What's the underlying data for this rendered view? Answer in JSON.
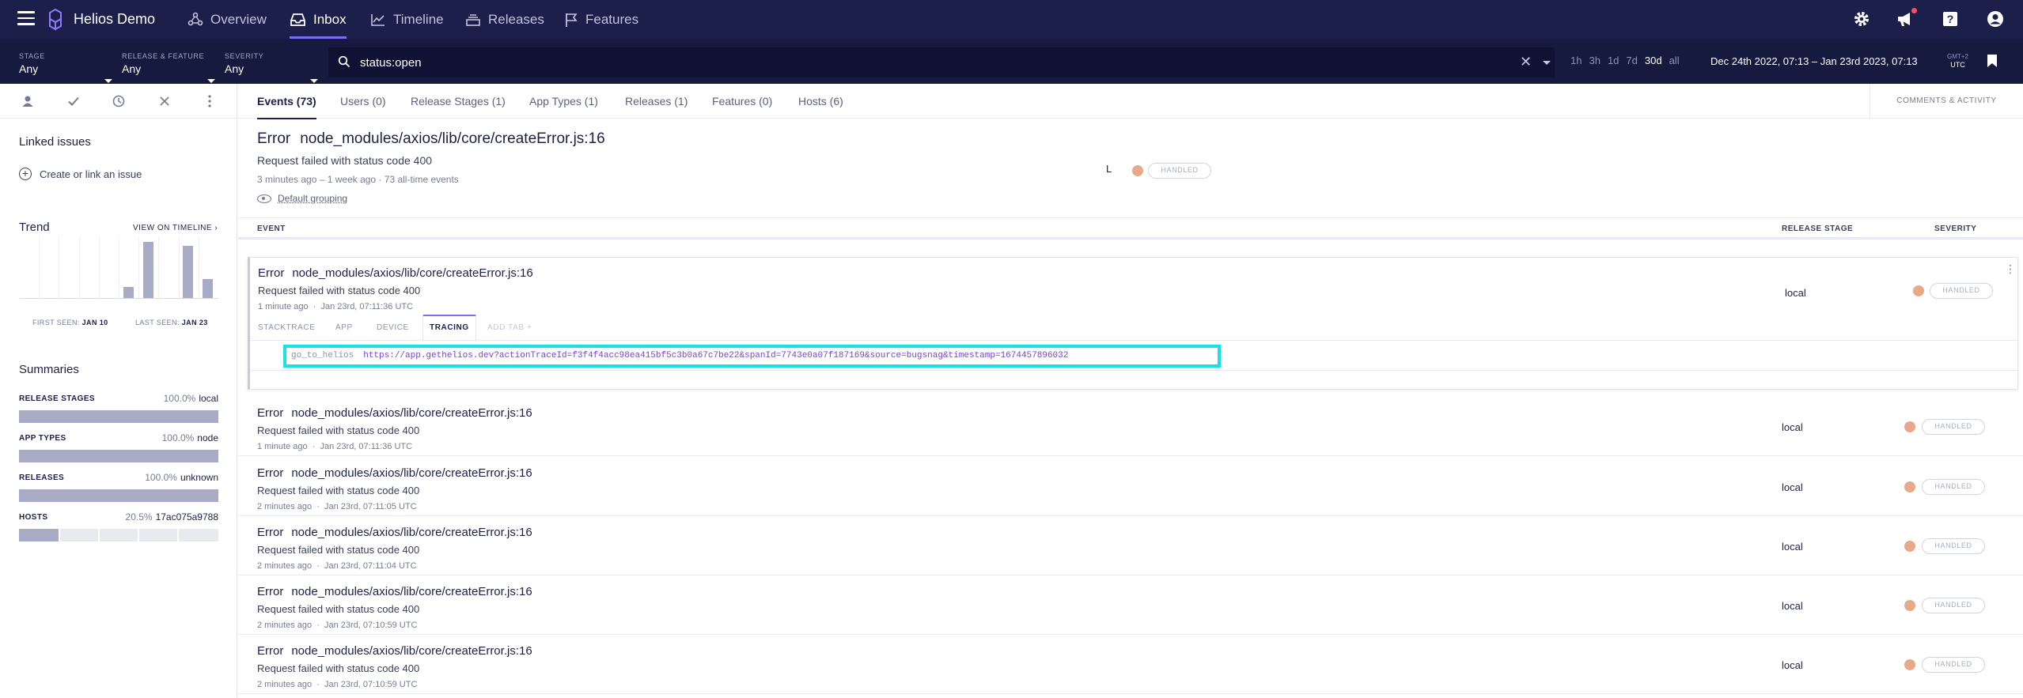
{
  "nav": {
    "brand": "Helios Demo",
    "items": [
      {
        "label": "Overview",
        "icon": "overview-icon"
      },
      {
        "label": "Inbox",
        "icon": "inbox-icon",
        "active": true
      },
      {
        "label": "Timeline",
        "icon": "timeline-icon"
      },
      {
        "label": "Releases",
        "icon": "releases-icon"
      },
      {
        "label": "Features",
        "icon": "flag-icon"
      }
    ],
    "right_icons": [
      "gear-icon",
      "megaphone-icon",
      "help-icon",
      "user-icon"
    ],
    "accent": "#7b6cf6",
    "bg": "#1b1f4a"
  },
  "filters": {
    "stage": {
      "label": "STAGE",
      "value": "Any"
    },
    "release_feature": {
      "label": "RELEASE & FEATURE",
      "value": "Any"
    },
    "severity": {
      "label": "SEVERITY",
      "value": "Any"
    },
    "search": {
      "value": "status:open",
      "placeholder": ""
    },
    "ranges": [
      "1h",
      "3h",
      "1d",
      "7d",
      "30d",
      "all"
    ],
    "active_range": "30d",
    "date_range": "Dec 24th 2022, 07:13 – Jan 23rd 2023, 07:13",
    "tz_label": "GMT+2",
    "tz_value": "UTC"
  },
  "sidebar": {
    "actions": [
      "assign-icon",
      "resolve-check-icon",
      "snooze-clock-icon",
      "discard-close-icon",
      "more-vertical-icon"
    ],
    "linked_issues_title": "Linked issues",
    "create_link": "Create or link an issue",
    "trend_title": "Trend",
    "view_on_timeline": "VIEW ON TIMELINE ›",
    "trend_values": [
      0,
      0,
      0,
      0,
      0,
      3,
      15,
      0,
      14,
      5
    ],
    "first_seen_label": "FIRST SEEN:",
    "first_seen": "JAN 10",
    "last_seen_label": "LAST SEEN:",
    "last_seen": "JAN 23",
    "summaries_title": "Summaries",
    "summaries": [
      {
        "label": "RELEASE STAGES",
        "pct": "100.0%",
        "value": "local",
        "fraction": 1.0
      },
      {
        "label": "APP TYPES",
        "pct": "100.0%",
        "value": "node",
        "fraction": 1.0
      },
      {
        "label": "RELEASES",
        "pct": "100.0%",
        "value": "unknown",
        "fraction": 1.0
      },
      {
        "label": "HOSTS",
        "pct": "20.5%",
        "value": "17ac075a9788",
        "fraction": 0.205
      }
    ]
  },
  "tabs": [
    "Events (73)",
    "Users (0)",
    "Release Stages (1)",
    "App Types (1)",
    "Releases (1)",
    "Features (0)",
    "Hosts (6)"
  ],
  "comments_tab": "COMMENTS & ACTIVITY",
  "error": {
    "class": "Error",
    "location": "node_modules/axios/lib/core/createError.js:16",
    "message": "Request failed with status code 400",
    "meta": "3 minutes ago – 1 week ago · 73 all-time events",
    "grouping": "Default grouping",
    "stage_short": "L",
    "severity": "HANDLED",
    "severity_color": "#e8a98a"
  },
  "columns": {
    "event": "EVENT",
    "release_stage": "RELEASE STAGE",
    "severity": "SEVERITY"
  },
  "expanded_event": {
    "class": "Error",
    "location": "node_modules/axios/lib/core/createError.js:16",
    "message": "Request failed with status code 400",
    "time": "1 minute ago",
    "date": "Jan 23rd, 07:11:36 UTC",
    "stage": "local",
    "severity": "HANDLED",
    "subtabs": [
      "STACKTRACE",
      "APP",
      "DEVICE",
      "TRACING",
      "ADD TAB +"
    ],
    "active_subtab": "TRACING",
    "tracing_key": "go_to_helios",
    "tracing_value": "https://app.gethelios.dev?actionTraceId=f3f4f4acc98ea415bf5c3b0a67c7be22&spanId=7743e0a07f187169&source=bugsnag&timestamp=1674457896032"
  },
  "events": [
    {
      "class": "Error",
      "location": "node_modules/axios/lib/core/createError.js:16",
      "message": "Request failed with status code 400",
      "time": "1 minute ago",
      "date": "Jan 23rd, 07:11:36 UTC",
      "stage": "local",
      "severity": "HANDLED"
    },
    {
      "class": "Error",
      "location": "node_modules/axios/lib/core/createError.js:16",
      "message": "Request failed with status code 400",
      "time": "2 minutes ago",
      "date": "Jan 23rd, 07:11:05 UTC",
      "stage": "local",
      "severity": "HANDLED"
    },
    {
      "class": "Error",
      "location": "node_modules/axios/lib/core/createError.js:16",
      "message": "Request failed with status code 400",
      "time": "2 minutes ago",
      "date": "Jan 23rd, 07:11:04 UTC",
      "stage": "local",
      "severity": "HANDLED"
    },
    {
      "class": "Error",
      "location": "node_modules/axios/lib/core/createError.js:16",
      "message": "Request failed with status code 400",
      "time": "2 minutes ago",
      "date": "Jan 23rd, 07:10:59 UTC",
      "stage": "local",
      "severity": "HANDLED"
    },
    {
      "class": "Error",
      "location": "node_modules/axios/lib/core/createError.js:16",
      "message": "Request failed with status code 400",
      "time": "2 minutes ago",
      "date": "Jan 23rd, 07:10:59 UTC",
      "stage": "local",
      "severity": "HANDLED"
    }
  ]
}
